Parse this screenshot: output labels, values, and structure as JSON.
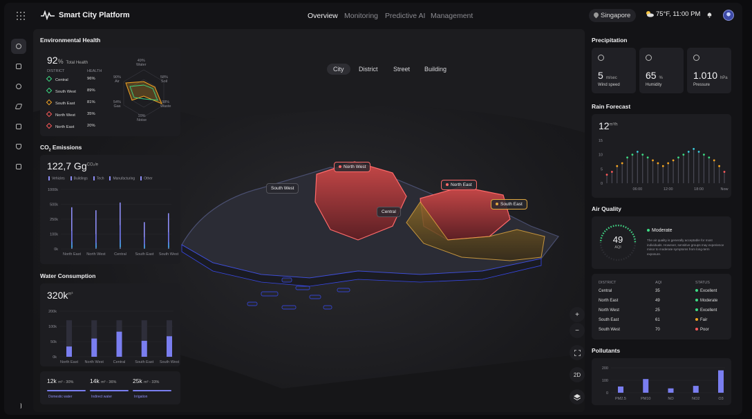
{
  "app": {
    "title": "Smart City Platform"
  },
  "nav": {
    "tabs": [
      "Overview",
      "Monitoring",
      "Predictive AI",
      "Management"
    ],
    "active": "Overview"
  },
  "header": {
    "location": "Singapore",
    "weather": "75°F, 11:00 PM"
  },
  "map_tabs": [
    "City",
    "District",
    "Street",
    "Building"
  ],
  "map_tags": {
    "north_west": "North West",
    "south_west": "South West",
    "central": "Central",
    "north_east": "North East",
    "south_east": "South East"
  },
  "map_controls": {
    "zoom_in": "+",
    "zoom_out": "−",
    "mode": "2D"
  },
  "env": {
    "title": "Environmental Health",
    "value": "92",
    "unit": "%",
    "caption": "Total Health",
    "col_district": "DISTRICT",
    "col_health": "HEALTH",
    "rows": [
      {
        "district": "Central",
        "health": "96%",
        "color": "#3ddc84"
      },
      {
        "district": "South West",
        "health": "89%",
        "color": "#3ddc84"
      },
      {
        "district": "South East",
        "health": "81%",
        "color": "#f5a623"
      },
      {
        "district": "North West",
        "health": "35%",
        "color": "#ff5a5a"
      },
      {
        "district": "North East",
        "health": "20%",
        "color": "#ff5a5a"
      }
    ],
    "radar": [
      {
        "pct": "49%",
        "name": "Water"
      },
      {
        "pct": "58%",
        "name": "Soil"
      },
      {
        "pct": "98%",
        "name": "Waste"
      },
      {
        "pct": "10%",
        "name": "Noise"
      },
      {
        "pct": "54%",
        "name": "Gas"
      },
      {
        "pct": "90%",
        "name": "Air"
      }
    ]
  },
  "co2": {
    "title_a": "CO",
    "title_sub": "2",
    "title_b": " Emissions",
    "value": "122,7 Gg",
    "unit": "CO₂/e",
    "legend": [
      "Vehicles",
      "Buildings",
      "Tech",
      "Manufacturing",
      "Other"
    ],
    "yticks": [
      "1000k",
      "500k",
      "250k",
      "100k",
      "0k"
    ],
    "categories": [
      "North East",
      "North West",
      "Central",
      "South East",
      "South West"
    ]
  },
  "water": {
    "title": "Water Consumption",
    "value": "320k",
    "unit": "m³",
    "yticks": [
      "200k",
      "100k",
      "50k",
      "0k"
    ],
    "categories": [
      "North East",
      "North West",
      "Central",
      "South East",
      "South West"
    ],
    "breakdown": [
      {
        "value": "12k",
        "detail": "m³ - 30%",
        "label": "Domestic water"
      },
      {
        "value": "14k",
        "detail": "m³ - 36%",
        "label": "Indirect water"
      },
      {
        "value": "25k",
        "detail": "m³ - 33%",
        "label": "Irrigation"
      }
    ]
  },
  "precip": {
    "title": "Precipitation",
    "stats": [
      {
        "value": "5",
        "unit": "m/sec",
        "label": "Wind speed"
      },
      {
        "value": "65",
        "unit": "%",
        "label": "Humidity"
      },
      {
        "value": "1.010",
        "unit": "hPa",
        "label": "Pressure"
      }
    ]
  },
  "rain": {
    "title": "Rain Forecast",
    "value": "12",
    "unit": "m³/h",
    "yticks": [
      "15",
      "10",
      "5",
      "0"
    ],
    "xticks": [
      "06:00",
      "12:00",
      "18:00",
      "Now"
    ]
  },
  "air": {
    "title": "Air Quality",
    "aqi": "49",
    "aqi_label": "AQI",
    "status": "Moderate",
    "description": "The air quality is generally acceptable for most individuals. However, sensitive groups may experience minor to moderate symptoms from long-term exposure.",
    "col_district": "DISTRICT",
    "col_aqi": "AQI",
    "col_status": "STATUS",
    "rows": [
      {
        "district": "Central",
        "aqi": "35",
        "status": "Excellent",
        "color": "#3ddc84"
      },
      {
        "district": "North East",
        "aqi": "49",
        "status": "Moderate",
        "color": "#3ddc84"
      },
      {
        "district": "North West",
        "aqi": "25",
        "status": "Excellent",
        "color": "#3ddc84"
      },
      {
        "district": "South East",
        "aqi": "61",
        "status": "Fair",
        "color": "#f5a623"
      },
      {
        "district": "South West",
        "aqi": "70",
        "status": "Poor",
        "color": "#ff5a5a"
      }
    ]
  },
  "pollutants": {
    "title": "Pollutants",
    "yticks": [
      "200",
      "100",
      "0"
    ],
    "categories": [
      "PM2.5",
      "PM10",
      "NO",
      "NO2",
      "O3"
    ]
  },
  "chart_data": [
    {
      "type": "bar",
      "title": "CO₂ Emissions",
      "categories": [
        "North East",
        "North West",
        "Central",
        "South East",
        "South West"
      ],
      "series": [
        {
          "name": "Vehicles",
          "values": [
            700,
            650,
            780,
            450,
            600
          ]
        },
        {
          "name": "Buildings",
          "values": [
            300,
            250,
            400,
            200,
            280
          ]
        },
        {
          "name": "Tech",
          "values": [
            120,
            100,
            150,
            80,
            110
          ]
        },
        {
          "name": "Manufacturing",
          "values": [
            60,
            50,
            80,
            40,
            55
          ]
        },
        {
          "name": "Other",
          "values": [
            20,
            20,
            30,
            15,
            20
          ]
        }
      ],
      "ylim": [
        0,
        1000
      ]
    },
    {
      "type": "bar",
      "title": "Water Consumption",
      "categories": [
        "North East",
        "North West",
        "Central",
        "South East",
        "South West"
      ],
      "values": [
        45,
        80,
        110,
        70,
        90
      ],
      "capacity": [
        160,
        160,
        160,
        160,
        160
      ],
      "ylim": [
        0,
        200
      ]
    },
    {
      "type": "line",
      "title": "Rain Forecast",
      "x": [
        "00:00",
        "01:00",
        "02:00",
        "03:00",
        "04:00",
        "05:00",
        "06:00",
        "07:00",
        "08:00",
        "09:00",
        "10:00",
        "11:00",
        "12:00",
        "13:00",
        "14:00",
        "15:00",
        "16:00",
        "17:00",
        "18:00",
        "19:00",
        "20:00",
        "21:00",
        "22:00",
        "23:00"
      ],
      "values": [
        3,
        4,
        6,
        7,
        9,
        10,
        11,
        10,
        9,
        8,
        7,
        6,
        7,
        8,
        9,
        10,
        11,
        12,
        11,
        10,
        9,
        8,
        6,
        4
      ],
      "ylim": [
        0,
        15
      ]
    },
    {
      "type": "bar",
      "title": "Pollutants",
      "categories": [
        "PM2.5",
        "PM10",
        "NO",
        "NO2",
        "O3"
      ],
      "values": [
        50,
        110,
        35,
        55,
        180
      ],
      "ylim": [
        0,
        200
      ]
    }
  ]
}
